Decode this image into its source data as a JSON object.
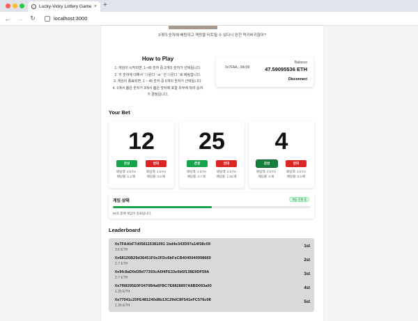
{
  "browser": {
    "tab_title": "Lucky-Vicky Lottery Game",
    "tab_close": "×",
    "new_tab": "+",
    "back": "←",
    "forward": "→",
    "reload": "↻",
    "url": "localhost:3000"
  },
  "hero": {
    "subtitle": "3개의 숫자에 베팅하고 잭팟을 터트릴 수 있다니 완전 럭키비키잖아?"
  },
  "how_to_play": {
    "title": "How to Play",
    "steps": [
      "1. 게임이 시작되면, 1~45 숫자 중 3개의 숫자가 선택됩니다.",
      "2. 각 숫자에 대해서 ' 나온다 ' or ' 안 나온다 ' 로 베팅합니다.",
      "3. 게임이 종료되면, 1 ~ 45 숫자 중 6개의 숫자가 선택됩니다.",
      "4. 1에서 뽑은 숫자가 3에서 뽑은 숫자에 포함 유무에 따라 승자",
      "가 결정됩니다."
    ]
  },
  "wallet": {
    "address": "0x7FAA...38c09",
    "balance_label": "Balance",
    "balance_value": "47.59095536 ETH",
    "disconnect_label": "Disconnect"
  },
  "your_bet": {
    "title": "Your Bet",
    "cards": [
      {
        "number": "12",
        "yes_label": "찬성",
        "no_label": "반대",
        "yes_bet": "베팅액: 3 ETH",
        "yes_ratio": "배당률: 1.2 배",
        "no_bet": "베팅액: 1 ETH",
        "no_ratio": "배당률: 3.6 배"
      },
      {
        "number": "25",
        "yes_label": "찬성",
        "no_label": "반대",
        "yes_bet": "베팅액: 1 ETH",
        "yes_ratio": "배당률: 2.7 배",
        "no_bet": "베팅액: 2 ETH",
        "no_ratio": "배당률: 1.35 배"
      },
      {
        "number": "4",
        "yes_label": "찬성",
        "no_label": "반대",
        "yes_bet": "베팅액: 0 ETH",
        "yes_ratio": "배당률: 0 배",
        "no_bet": "베팅액: 3 ETH",
        "no_ratio": "배당률: 0.9 배"
      }
    ]
  },
  "game_status": {
    "title": "게임 상태",
    "badge": "게임 진행 중",
    "progress": 0.5,
    "message": "50초 후에 게임이 종료됩니다."
  },
  "leaderboard": {
    "title": "Leaderboard",
    "rows": [
      {
        "address": "0x7FAAbF7d058115381091 1bd4e343D97a14f38c09",
        "amount": "3.6 ETH",
        "rank": "1st"
      },
      {
        "address": "0x68126B29d36451F0e2FDc6bFeCB4045940998669",
        "amount": "2.7 ETH",
        "rank": "2st"
      },
      {
        "address": "0x9fc8aD0d39d77393cA6f4FE33e0b5f138E9DF59A",
        "amount": "2.7 ETH",
        "rank": "3st"
      },
      {
        "address": "0x7f98395E0F0470B4a6FBC7E8828897A8BD093a00",
        "amount": "1.35 ETH",
        "rank": "4st"
      },
      {
        "address": "0x77041c20FE481240d8b13C29dC8F541eFC576c08",
        "amount": "1.35 ETH",
        "rank": "5st"
      }
    ]
  }
}
